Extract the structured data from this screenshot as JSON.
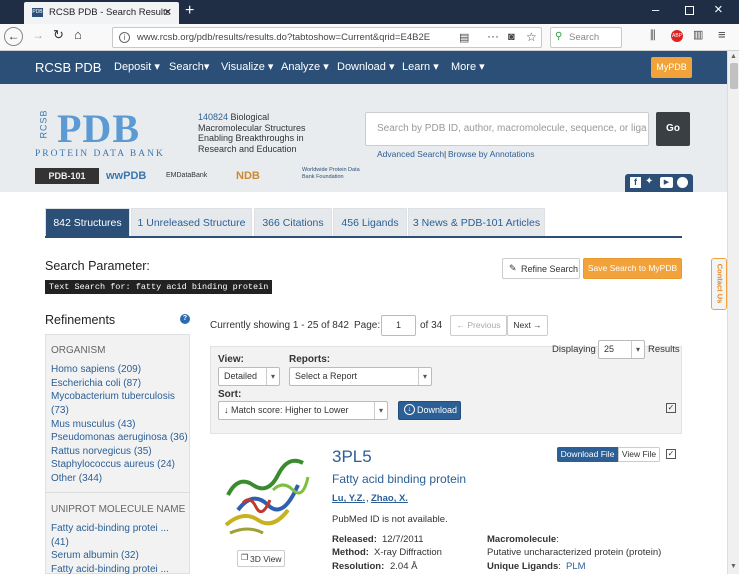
{
  "browser": {
    "tab_title": "RCSB PDB - Search Results",
    "url": "www.rcsb.org/pdb/results/results.do?tabtoshow=Current&qrid=E4B2E",
    "search_placeholder": "Search"
  },
  "nav": {
    "brand": "RCSB PDB",
    "items": [
      "Deposit",
      "Search",
      "Visualize",
      "Analyze",
      "Download",
      "Learn",
      "More"
    ],
    "mypdb": "MyPDB"
  },
  "hero": {
    "logo_letters": "PDB",
    "logo_vert": "RCSB",
    "logo_sub": "PROTEIN DATA BANK",
    "count": "140824",
    "tagline_1": " Biological",
    "tagline_2": "Macromolecular Structures",
    "tagline_3": "Enabling Breakthroughs in",
    "tagline_4": "Research and Education",
    "search_placeholder": "Search by PDB ID, author, macromolecule, sequence, or liga",
    "go": "Go",
    "advanced": "Advanced Search",
    "sep": "|",
    "browse": "Browse by Annotations",
    "partners": [
      "PDB-101",
      "wwPDB",
      "EMDataBank",
      "NDB",
      "Worldwide Protein Data Bank Foundation"
    ]
  },
  "tabs": [
    "842 Structures",
    "1 Unreleased Structure",
    "366 Citations",
    "456 Ligands",
    "3 News & PDB-101 Articles"
  ],
  "search": {
    "param_label": "Search Parameter:",
    "param_value": "Text Search for: fatty acid binding protein",
    "refine_btn": "Refine Search",
    "save_btn": "Save Search to MyPDB"
  },
  "refinements": {
    "title": "Refinements",
    "organism_header": "ORGANISM",
    "organisms": [
      "Homo sapiens (209)",
      "Escherichia coli (87)",
      "Mycobacterium tuberculosis",
      "(73)",
      "Mus musculus (43)",
      "Pseudomonas aeruginosa (36)",
      "Rattus norvegicus (35)",
      "Staphylococcus aureus (24)",
      "Other (344)"
    ],
    "uniprot_header": "UNIPROT MOLECULE NAME",
    "uniprot": [
      "Fatty acid-binding protei ...",
      "(41)",
      "Serum albumin (32)",
      "Fatty acid-binding protei ..."
    ]
  },
  "results": {
    "showing": "Currently showing 1 - 25 of 842",
    "page_label": "Page:",
    "page_value": "1",
    "of_pages": "of 34",
    "prev": "← Previous",
    "next": "Next →",
    "view_label": "View:",
    "view_value": "Detailed",
    "reports_label": "Reports:",
    "reports_value": "Select a Report",
    "displaying_label": "Displaying",
    "displaying_value": "25",
    "results_label": "Results",
    "sort_label": "Sort:",
    "sort_value": "↓ Match score: Higher to Lower",
    "download_btn": "Download"
  },
  "entry": {
    "id": "3PL5",
    "title": "Fatty acid binding protein",
    "author_1": "Lu, Y.Z.",
    "author_sep": ",",
    "author_2": "Zhao, X.",
    "pubmed": "PubMed ID is not available.",
    "released_label": "Released:",
    "released_value": "12/7/2011",
    "method_label": "Method:",
    "method_value": "X-ray Diffraction",
    "resolution_label": "Resolution:",
    "resolution_value": "2.04 Å",
    "macro_label": "Macromolecule",
    "macro_colon": ":",
    "macro_value": "Putative uncharacterized protein (protein)",
    "ligands_label": "Unique Ligands",
    "ligands_colon": ":",
    "ligands_value": "PLM",
    "view3d": "3D View",
    "download_file": "Download File",
    "view_file": "View File"
  },
  "contact": "Contact Us",
  "colors": {
    "nav": "#2b4f76",
    "accent": "#f2a23a",
    "link": "#2b5f96",
    "tab_active": "#2b4f76"
  }
}
